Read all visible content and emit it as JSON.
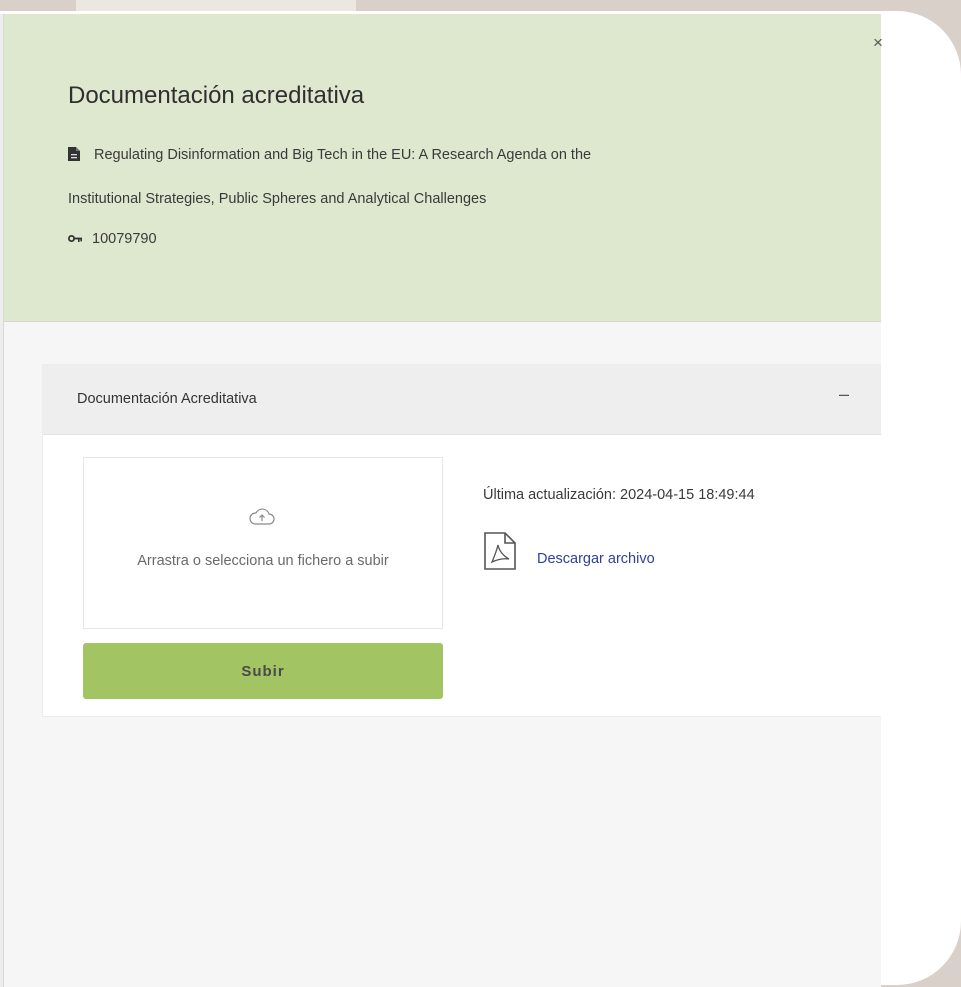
{
  "modal": {
    "title": "Documentación acreditativa",
    "close_icon": "×",
    "publication": {
      "title_line1": "Regulating Disinformation and Big Tech in the EU: A Research Agenda on the",
      "title_line2": "Institutional Strategies, Public Spheres and Analytical Challenges",
      "id": "10079790",
      "doc_icon": "document-icon",
      "id_icon": "key-icon"
    }
  },
  "panel": {
    "title": "Documentación Acreditativa",
    "collapse_symbol": "–",
    "dropzone": {
      "text": "Arrastra o selecciona un fichero a subir",
      "icon": "upload-cloud-icon"
    },
    "upload_button": "Subir",
    "last_update": "Última actualización: 2024-04-15 18:49:44",
    "download_icon": "pdf-file-icon",
    "download_link": "Descargar archivo"
  },
  "colors": {
    "header_bg": "#dde8cf",
    "button_bg": "#a2c463",
    "link": "#2f3f9e",
    "outer_bg": "#d9d1c9"
  }
}
